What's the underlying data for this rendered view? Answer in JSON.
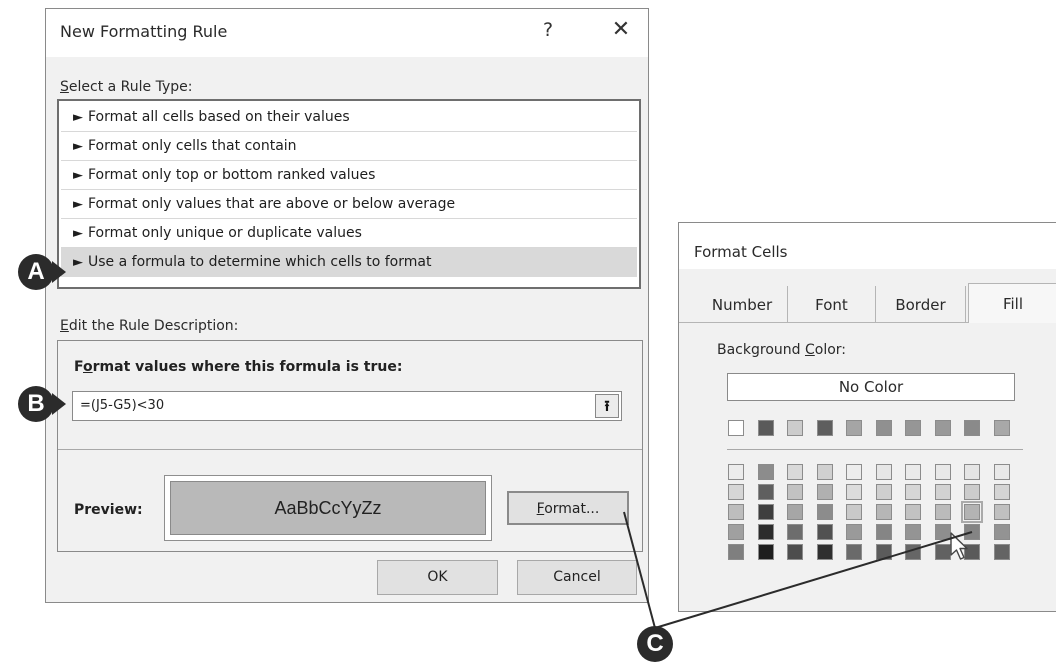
{
  "new_formatting_rule": {
    "title": "New Formatting Rule",
    "help_glyph": "?",
    "close_glyph": "✕",
    "select_rule_type_label": {
      "mnemonic": "S",
      "rest": "elect a Rule Type:"
    },
    "rule_types": [
      "Format all cells based on their values",
      "Format only cells that contain",
      "Format only top or bottom ranked values",
      "Format only values that are above or below average",
      "Format only unique or duplicate values",
      "Use a formula to determine which cells to format"
    ],
    "rule_arrow": "►",
    "selected_rule_index": 5,
    "edit_description_label": {
      "mnemonic": "E",
      "rest": "dit the Rule Description:"
    },
    "formula_label": {
      "pre": "F",
      "mnemonic": "o",
      "rest": "rmat values where this formula is true:"
    },
    "formula_value": "=(J5-G5)<30",
    "collapse_glyph": "⭱",
    "preview_label": "Preview:",
    "preview_sample": "AaBbCcYyZz",
    "format_button": {
      "mnemonic": "F",
      "rest": "ormat..."
    },
    "ok_button": "OK",
    "cancel_button": "Cancel"
  },
  "format_cells": {
    "title": "Format Cells",
    "tabs": [
      "Number",
      "Font",
      "Border",
      "Fill"
    ],
    "active_tab": "Fill",
    "background_color_label": {
      "pre": "Background ",
      "mnemonic": "C",
      "rest": "olor:"
    },
    "no_color_button": "No Color",
    "theme_top_row": [
      "#ffffff",
      "#5a5a5a",
      "#cccccc",
      "#5e5e5e",
      "#a5a5a5",
      "#909090",
      "#969696",
      "#999999",
      "#8a8a8a",
      "#a8a8a8"
    ],
    "palette_rows": [
      [
        "#ececec",
        "#8c8c8c",
        "#d9d9d9",
        "#d0d0d0",
        "#ededed",
        "#e6e6e6",
        "#eaeaea",
        "#e8e8e8",
        "#e5e5e5",
        "#e9e9e9"
      ],
      [
        "#d6d6d6",
        "#5f5f5f",
        "#c2c2c2",
        "#b0b0b0",
        "#dcdcdc",
        "#cfcfcf",
        "#d6d6d6",
        "#d2d2d2",
        "#cccccc",
        "#d5d5d5"
      ],
      [
        "#bdbdbd",
        "#3e3e3e",
        "#a6a6a6",
        "#8c8c8c",
        "#c9c9c9",
        "#b6b6b6",
        "#c2c2c2",
        "#bbbbbb",
        "#b3b3b3",
        "#c0c0c0"
      ],
      [
        "#a0a0a0",
        "#2c2c2c",
        "#6d6d6d",
        "#515151",
        "#9a9a9a",
        "#858585",
        "#949494",
        "#8e8e8e",
        "#848484",
        "#939393"
      ],
      [
        "#7f7f7f",
        "#1e1e1e",
        "#4d4d4d",
        "#2f2f2f",
        "#6a6a6a",
        "#5b5b5b",
        "#666666",
        "#616161",
        "#5a5a5a",
        "#646464"
      ]
    ],
    "hovered_swatch": {
      "row": 2,
      "col": 8
    }
  },
  "callouts": {
    "a": "A",
    "b": "B",
    "c": "C"
  }
}
